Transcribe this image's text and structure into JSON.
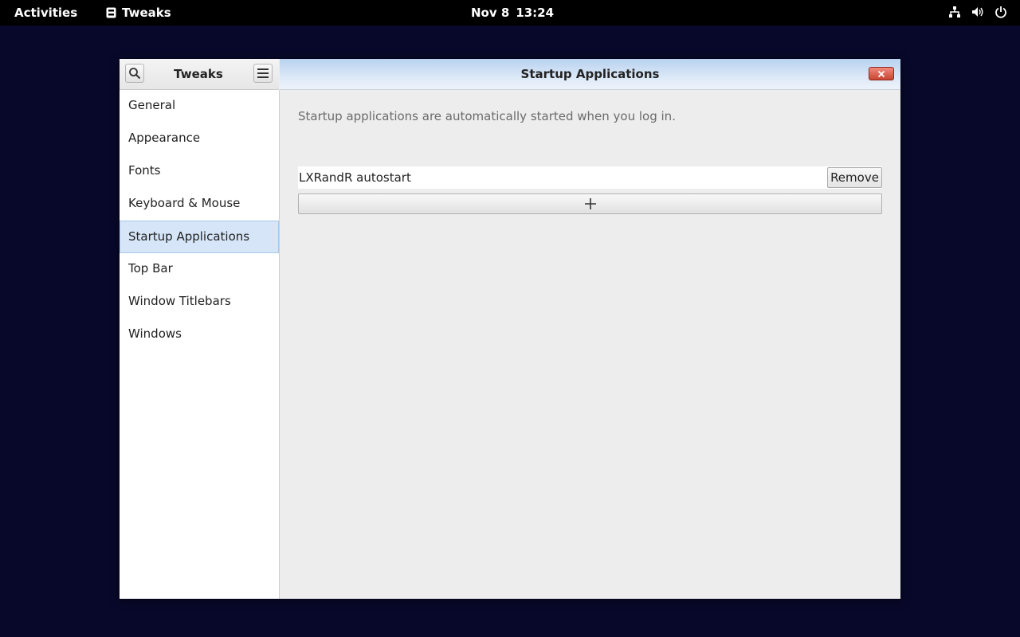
{
  "topbar": {
    "activities": "Activities",
    "app_name": "Tweaks",
    "app_icon": "tweaks-app-icon",
    "date": "Nov 8",
    "time": "13:24",
    "status_icons": [
      "network-icon",
      "volume-icon",
      "power-icon"
    ]
  },
  "window": {
    "sidebar_title": "Tweaks",
    "search_icon": "search-icon",
    "menu_icon": "hamburger-menu-icon",
    "main_title": "Startup Applications",
    "close_icon": "close-icon",
    "sidebar_items": [
      {
        "label": "General"
      },
      {
        "label": "Appearance"
      },
      {
        "label": "Fonts"
      },
      {
        "label": "Keyboard & Mouse"
      },
      {
        "label": "Startup Applications",
        "selected": true
      },
      {
        "label": "Top Bar"
      },
      {
        "label": "Window Titlebars"
      },
      {
        "label": "Windows"
      }
    ]
  },
  "content": {
    "description": "Startup applications are automatically started when you log in.",
    "apps": [
      {
        "name": "LXRandR autostart",
        "remove_label": "Remove"
      }
    ],
    "add_icon": "plus-icon"
  },
  "colors": {
    "desktop_bg": "#08082a",
    "selection": "#d6e6f8",
    "header_gradient_top": "#b8d2ef",
    "close_button": "#c84433"
  }
}
